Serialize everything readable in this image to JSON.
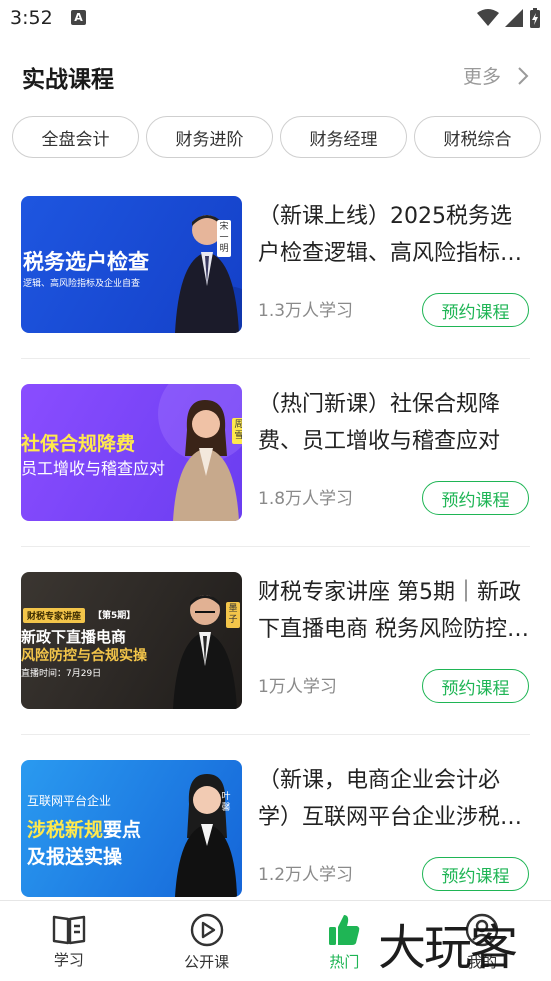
{
  "status": {
    "time": "3:52"
  },
  "header": {
    "title": "实战课程",
    "more_label": "更多"
  },
  "tabs": [
    {
      "label": "全盘会计"
    },
    {
      "label": "财务进阶"
    },
    {
      "label": "财务经理"
    },
    {
      "label": "财税综合"
    }
  ],
  "courses": [
    {
      "title": "（新课上线）2025税务选户检查逻辑、高风险指标及企业自查",
      "count": "1.3万人学习",
      "button": "预约课程",
      "thumb": {
        "headline": "税务选户检查",
        "sub": "逻辑、高风险指标及企业自查",
        "name": "宋一明",
        "bg": "#1d4fd8"
      }
    },
    {
      "title": "（热门新课）社保合规降费、员工增收与稽查应对",
      "count": "1.8万人学习",
      "button": "预约课程",
      "thumb": {
        "headline": "社保合规降费",
        "sub": "员工增收与稽查应对",
        "name": "周雪",
        "bg": "#7c4dff"
      }
    },
    {
      "title": "财税专家讲座 第5期｜新政下直播电商 税务风险防控与合规实操",
      "count": "1万人学习",
      "button": "预约课程",
      "thumb": {
        "tag": "财税专家讲座",
        "period": "【第5期】",
        "headline1": "新政下直播电商",
        "headline2": "风险防控与合规实操",
        "date": "直播时间：7月29日",
        "name": "墨子",
        "bg": "#2a2a2a"
      }
    },
    {
      "title": "（新课，电商企业会计必学）互联网平台企业涉税新规要点及报送实操",
      "count": "1.2万人学习",
      "button": "预约课程",
      "thumb": {
        "top": "互联网平台企业",
        "headline1a": "涉税新规",
        "headline1b": "要点",
        "headline2": "及报送实操",
        "name": "叶馨",
        "bg": "#1e88e5"
      }
    }
  ],
  "nav": [
    {
      "label": "学习",
      "icon": "book-icon"
    },
    {
      "label": "公开课",
      "icon": "play-circle-icon"
    },
    {
      "label": "热门",
      "icon": "thumbs-up-icon"
    },
    {
      "label": "我的",
      "icon": "user-icon"
    }
  ],
  "watermark": "大玩客",
  "colors": {
    "accent": "#1fb555"
  }
}
